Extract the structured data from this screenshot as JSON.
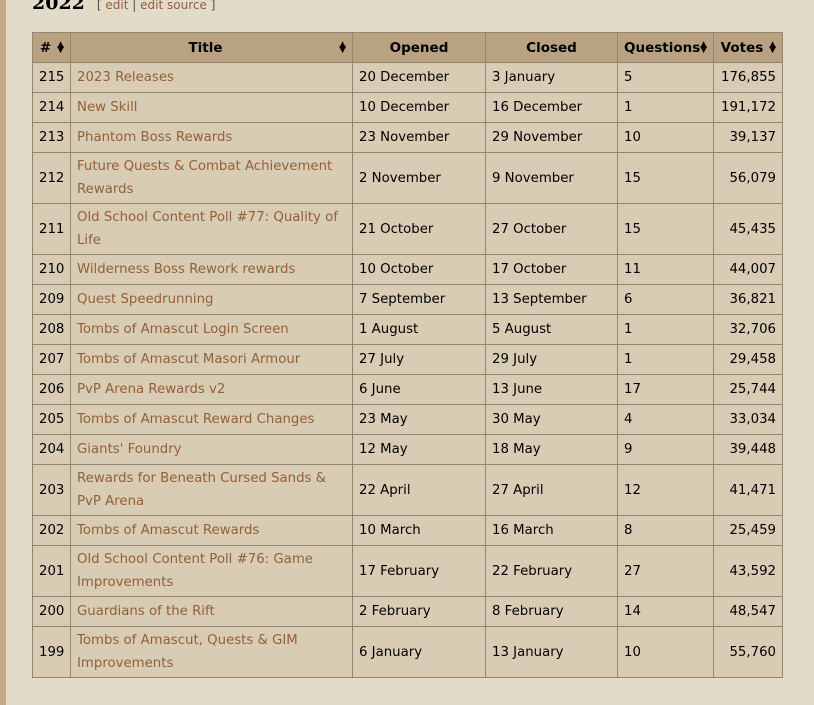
{
  "section": {
    "year": "2022",
    "edit_open": "[",
    "edit_label": "edit",
    "edit_sep": "|",
    "edit_source_label": "edit source",
    "edit_close": "]"
  },
  "table": {
    "headers": {
      "num": "#",
      "title": "Title",
      "opened": "Opened",
      "closed": "Closed",
      "questions": "Questions",
      "votes": "Votes"
    },
    "sort_icon": "sort-arrows-icon",
    "rows": [
      {
        "num": "215",
        "title": "2023 Releases",
        "opened": "20 December",
        "closed": "3 January",
        "questions": "5",
        "votes": "176,855"
      },
      {
        "num": "214",
        "title": "New Skill",
        "opened": "10 December",
        "closed": "16 December",
        "questions": "1",
        "votes": "191,172"
      },
      {
        "num": "213",
        "title": "Phantom Boss Rewards",
        "opened": "23 November",
        "closed": "29 November",
        "questions": "10",
        "votes": "39,137"
      },
      {
        "num": "212",
        "title": "Future Quests & Combat Achievement Rewards",
        "opened": "2 November",
        "closed": "9 November",
        "questions": "15",
        "votes": "56,079"
      },
      {
        "num": "211",
        "title": "Old School Content Poll #77: Quality of Life",
        "opened": "21 October",
        "closed": "27 October",
        "questions": "15",
        "votes": "45,435"
      },
      {
        "num": "210",
        "title": "Wilderness Boss Rework rewards",
        "opened": "10 October",
        "closed": "17 October",
        "questions": "11",
        "votes": "44,007"
      },
      {
        "num": "209",
        "title": "Quest Speedrunning",
        "opened": "7 September",
        "closed": "13 September",
        "questions": "6",
        "votes": "36,821"
      },
      {
        "num": "208",
        "title": "Tombs of Amascut Login Screen",
        "opened": "1 August",
        "closed": "5 August",
        "questions": "1",
        "votes": "32,706"
      },
      {
        "num": "207",
        "title": "Tombs of Amascut Masori Armour",
        "opened": "27 July",
        "closed": "29 July",
        "questions": "1",
        "votes": "29,458"
      },
      {
        "num": "206",
        "title": "PvP Arena Rewards v2",
        "opened": "6 June",
        "closed": "13 June",
        "questions": "17",
        "votes": "25,744"
      },
      {
        "num": "205",
        "title": "Tombs of Amascut Reward Changes",
        "opened": "23 May",
        "closed": "30 May",
        "questions": "4",
        "votes": "33,034"
      },
      {
        "num": "204",
        "title": "Giants' Foundry",
        "opened": "12 May",
        "closed": "18 May",
        "questions": "9",
        "votes": "39,448"
      },
      {
        "num": "203",
        "title": "Rewards for Beneath Cursed Sands & PvP Arena",
        "opened": "22 April",
        "closed": "27 April",
        "questions": "12",
        "votes": "41,471"
      },
      {
        "num": "202",
        "title": "Tombs of Amascut Rewards",
        "opened": "10 March",
        "closed": "16 March",
        "questions": "8",
        "votes": "25,459"
      },
      {
        "num": "201",
        "title": "Old School Content Poll #76: Game Improvements",
        "opened": "17 February",
        "closed": "22 February",
        "questions": "27",
        "votes": "43,592"
      },
      {
        "num": "200",
        "title": "Guardians of the Rift",
        "opened": "2 February",
        "closed": "8 February",
        "questions": "14",
        "votes": "48,547"
      },
      {
        "num": "199",
        "title": "Tombs of Amascut, Quests & GIM Improvements",
        "opened": "6 January",
        "closed": "13 January",
        "questions": "10",
        "votes": "55,760"
      }
    ]
  }
}
